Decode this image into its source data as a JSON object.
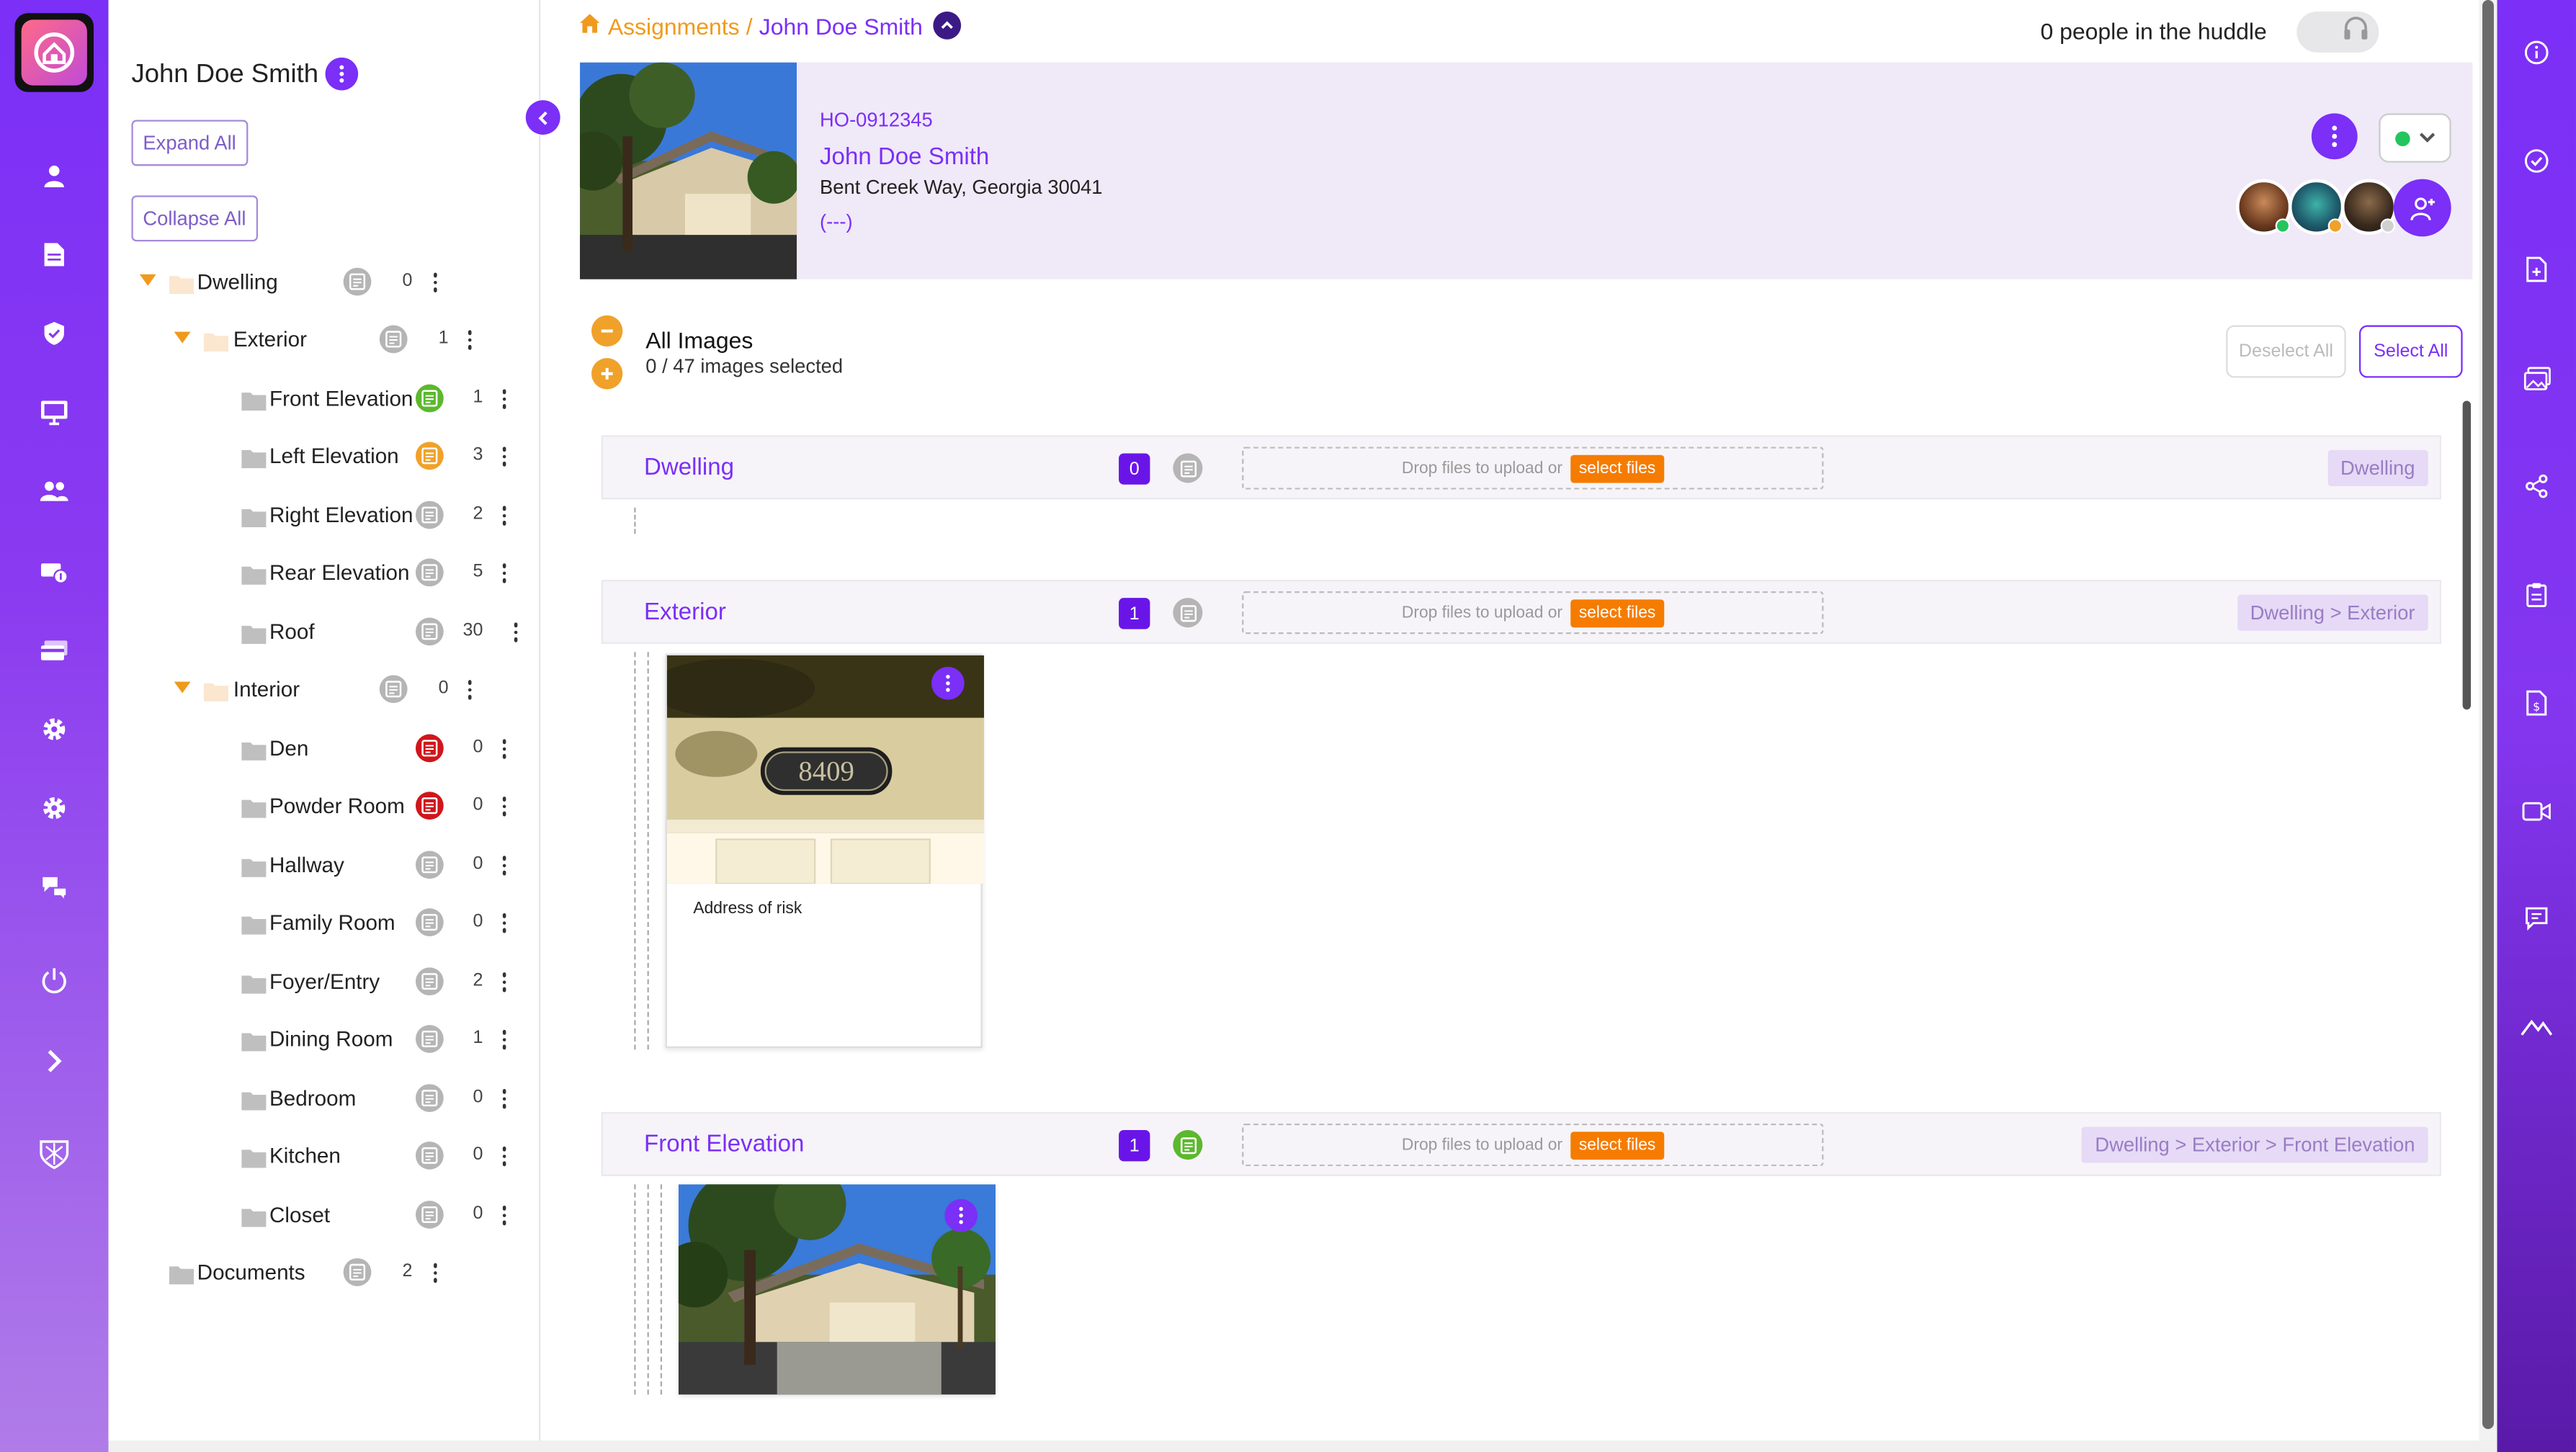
{
  "header": {
    "breadcrumb_root": "Assignments",
    "breadcrumb_sep": "/",
    "breadcrumb_current": "John Doe Smith",
    "huddle_text": "0 people in the huddle"
  },
  "tree": {
    "title": "John Doe Smith",
    "expand_all": "Expand All",
    "collapse_all": "Collapse All",
    "rows": [
      {
        "label": "Dwelling",
        "count": "0",
        "note": "gray"
      },
      {
        "label": "Exterior",
        "count": "1",
        "note": "gray"
      },
      {
        "label": "Front Elevation",
        "count": "1",
        "note": "green"
      },
      {
        "label": "Left Elevation",
        "count": "3",
        "note": "orange"
      },
      {
        "label": "Right Elevation",
        "count": "2",
        "note": "gray"
      },
      {
        "label": "Rear Elevation",
        "count": "5",
        "note": "gray"
      },
      {
        "label": "Roof",
        "count": "30",
        "note": "gray"
      },
      {
        "label": "Interior",
        "count": "0",
        "note": "gray"
      },
      {
        "label": "Den",
        "count": "0",
        "note": "red"
      },
      {
        "label": "Powder Room",
        "count": "0",
        "note": "red"
      },
      {
        "label": "Hallway",
        "count": "0",
        "note": "gray"
      },
      {
        "label": "Family Room",
        "count": "0",
        "note": "gray"
      },
      {
        "label": "Foyer/Entry",
        "count": "2",
        "note": "gray"
      },
      {
        "label": "Dining Room",
        "count": "1",
        "note": "gray"
      },
      {
        "label": "Bedroom",
        "count": "0",
        "note": "gray"
      },
      {
        "label": "Kitchen",
        "count": "0",
        "note": "gray"
      },
      {
        "label": "Closet",
        "count": "0",
        "note": "gray"
      },
      {
        "label": "Documents",
        "count": "2",
        "note": "gray"
      }
    ]
  },
  "card": {
    "id": "HO-0912345",
    "name": "John Doe Smith",
    "address": "Bent Creek Way, Georgia 30041",
    "phone": "(---)"
  },
  "images": {
    "title": "All Images",
    "count_text": "0 / 47 images selected",
    "deselect_all": "Deselect All",
    "select_all": "Select All",
    "drop_text": "Drop files to upload or",
    "select_files": "select files",
    "sections": [
      {
        "title": "Dwelling",
        "count": "0",
        "path": "Dwelling",
        "note": "gray"
      },
      {
        "title": "Exterior",
        "count": "1",
        "path": "Dwelling > Exterior",
        "note": "gray"
      },
      {
        "title": "Front Elevation",
        "count": "1",
        "path": "Dwelling > Exterior > Front Elevation",
        "note": "green"
      }
    ],
    "exterior_image_caption": "Address of risk",
    "house_number": "8409"
  },
  "colors": {
    "brand_purple": "#7b2ff7",
    "accent_orange": "#f09a1c",
    "note_green": "#5cb82e",
    "note_orange": "#f0a12a",
    "note_red": "#d0161b",
    "note_gray": "#b5b5b5"
  },
  "icons": {
    "left_rail": [
      "user-icon",
      "document-icon",
      "shield-icon",
      "monitor-icon",
      "group-icon",
      "money-icon",
      "card-icon",
      "gear-icon",
      "gear-alt-icon",
      "support-icon",
      "power-icon",
      "chevron-right-icon",
      "brand-logo-icon"
    ],
    "right_rail": [
      "info-icon",
      "check-circle-icon",
      "file-add-icon",
      "images-icon",
      "share-icon",
      "clipboard-icon",
      "file-dollar-icon",
      "video-icon",
      "chat-icon",
      "mountain-icon"
    ]
  }
}
